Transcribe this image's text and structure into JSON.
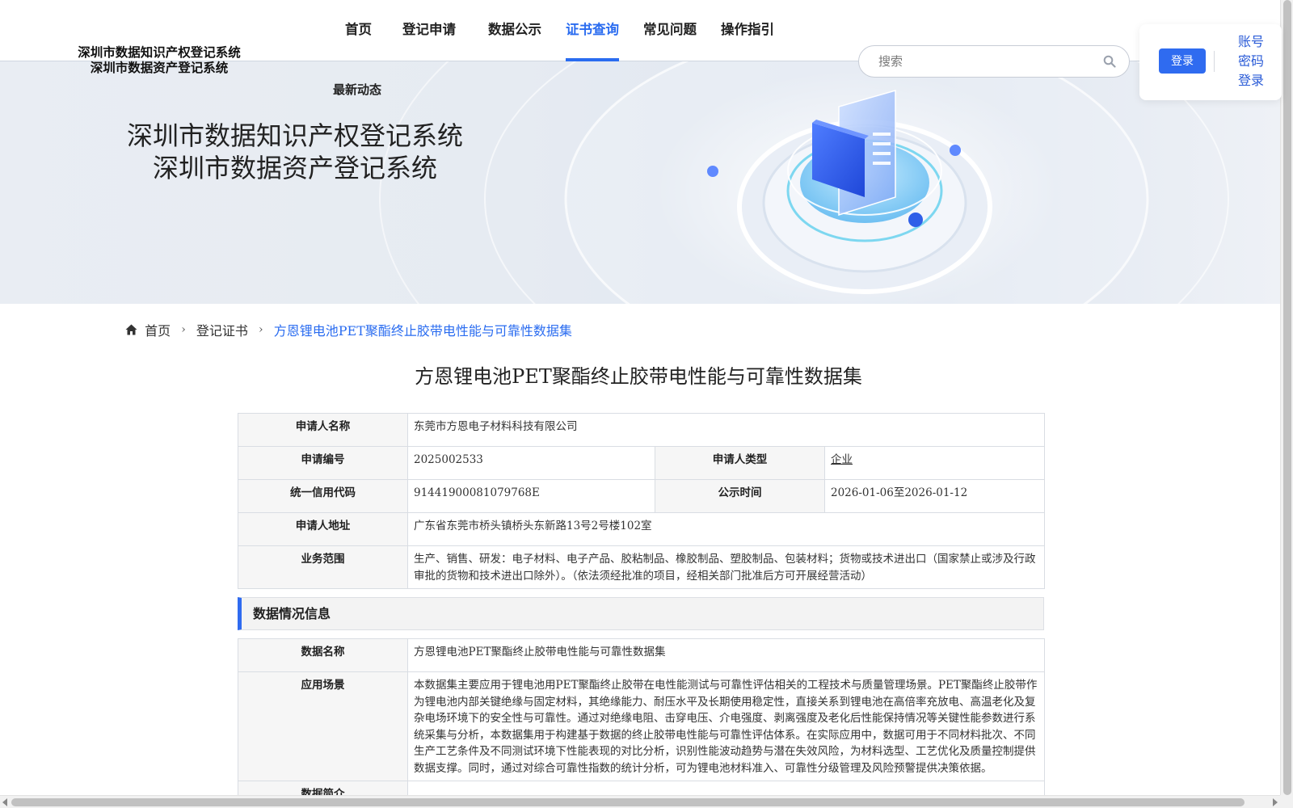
{
  "header": {
    "logo_line1": "深圳市数据知识产权登记系统",
    "logo_line2": "深圳市数据资产登记系统",
    "nav": [
      {
        "label": "首页",
        "active": false
      },
      {
        "label": "登记申请",
        "active": false
      },
      {
        "label": "数据公示",
        "active": false
      },
      {
        "label": "证书查询",
        "active": true
      },
      {
        "label": "常见问题",
        "active": false
      },
      {
        "label": "操作指引",
        "active": false
      }
    ],
    "nav_extra": "最新动态",
    "search_placeholder": "搜索",
    "login_button": "登录",
    "account_links": [
      "账号",
      "密码",
      "登录"
    ],
    "accent_color": "#2a6cf0"
  },
  "banner": {
    "title_line1": "深圳市数据知识产权登记系统",
    "title_line2": "深圳市数据资产登记系统"
  },
  "breadcrumb": {
    "home": "首页",
    "level2": "登记证书",
    "current": "方恩锂电池PET聚酯终止胶带电性能与可靠性数据集"
  },
  "page_title": "方恩锂电池PET聚酯终止胶带电性能与可靠性数据集",
  "applicant": {
    "name_label": "申请人名称",
    "name_value": "东莞市方恩电子材料科技有限公司",
    "app_no_label": "申请编号",
    "app_no_value": "2025002533",
    "type_label": "申请人类型",
    "type_value": "企业",
    "credit_label": "统一信用代码",
    "credit_value": "91441900081079768E",
    "publicity_label": "公示时间",
    "publicity_value": "2026-01-06至2026-01-12",
    "address_label": "申请人地址",
    "address_value": "广东省东莞市桥头镇桥头东新路13号2号楼102室",
    "scope_label": "业务范围",
    "scope_value": "生产、销售、研发：电子材料、电子产品、胶粘制品、橡胶制品、塑胶制品、包装材料；货物或技术进出口（国家禁止或涉及行政审批的货物和技术进出口除外）。（依法须经批准的项目，经相关部门批准后方可开展经营活动）"
  },
  "data_section": {
    "heading": "数据情况信息",
    "data_name_label": "数据名称",
    "data_name_value": "方恩锂电池PET聚酯终止胶带电性能与可靠性数据集",
    "scenario_label": "应用场景",
    "scenario_value": "本数据集主要应用于锂电池用PET聚酯终止胶带在电性能测试与可靠性评估相关的工程技术与质量管理场景。PET聚酯终止胶带作为锂电池内部关键绝缘与固定材料，其绝缘能力、耐压水平及长期使用稳定性，直接关系到锂电池在高倍率充放电、高温老化及复杂电场环境下的安全性与可靠性。通过对绝缘电阻、击穿电压、介电强度、剥离强度及老化后性能保持情况等关键性能参数进行系统采集与分析，本数据集用于构建基于数据的终止胶带电性能与可靠性评估体系。在实际应用中，数据可用于不同材料批次、不同生产工艺条件及不同测试环境下性能表现的对比分析，识别性能波动趋势与潜在失效风险，为材料选型、工艺优化及质量控制提供数据支撑。同时，通过对综合可靠性指数的统计分析，可为锂电池材料准入、可靠性分级管理及风险预警提供决策依据。",
    "next_row_label": "数据简介"
  }
}
